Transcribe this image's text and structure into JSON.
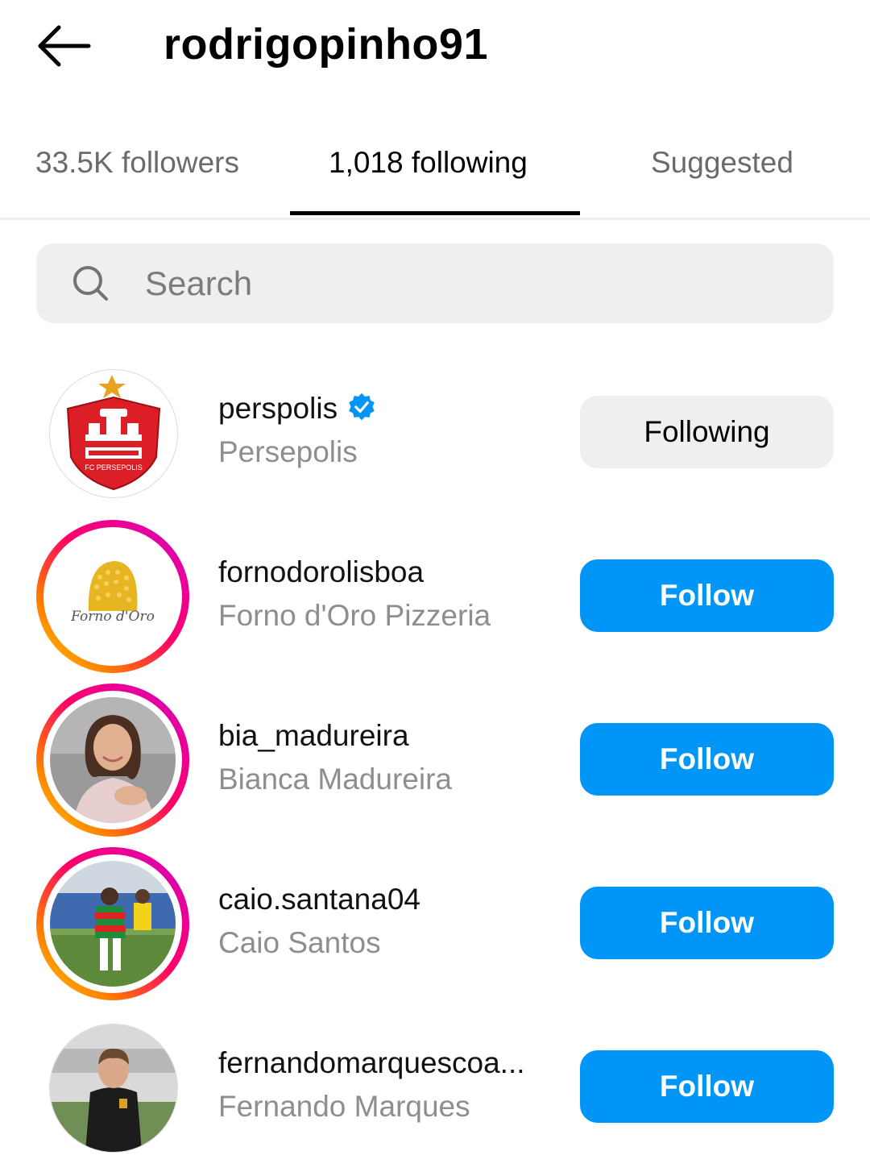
{
  "header": {
    "title": "rodrigopinho91",
    "back_icon": "arrow-left-icon"
  },
  "tabs": [
    {
      "label": "33.5K followers",
      "active": false
    },
    {
      "label": "1,018 following",
      "active": true
    },
    {
      "label": "Suggested",
      "active": false
    }
  ],
  "search": {
    "placeholder": "Search",
    "value": ""
  },
  "list": [
    {
      "username": "perspolis",
      "full_name": "Persepolis",
      "verified": true,
      "story_ring": false,
      "button": "Following",
      "avatar": "fc-persepolis-logo"
    },
    {
      "username": "fornodorolisboa",
      "full_name": "Forno d'Oro Pizzeria",
      "verified": false,
      "story_ring": true,
      "button": "Follow",
      "avatar": "forno-doro-logo"
    },
    {
      "username": "bia_madureira",
      "full_name": "Bianca Madureira",
      "verified": false,
      "story_ring": true,
      "button": "Follow",
      "avatar": "person-photo"
    },
    {
      "username": "caio.santana04",
      "full_name": "Caio Santos",
      "verified": false,
      "story_ring": true,
      "button": "Follow",
      "avatar": "football-player-photo"
    },
    {
      "username": "fernandomarquescoa...",
      "full_name": "Fernando Marques",
      "verified": false,
      "story_ring": false,
      "button": "Follow",
      "avatar": "coach-photo"
    }
  ],
  "colors": {
    "follow_button": "#0095f6",
    "following_button": "#efefef",
    "verified_badge": "#0095f6",
    "secondary_text": "#8e8e8e"
  },
  "logo_text": {
    "persepolis": "FC PERSEPOLIS",
    "forno": "Forno d'Oro"
  }
}
